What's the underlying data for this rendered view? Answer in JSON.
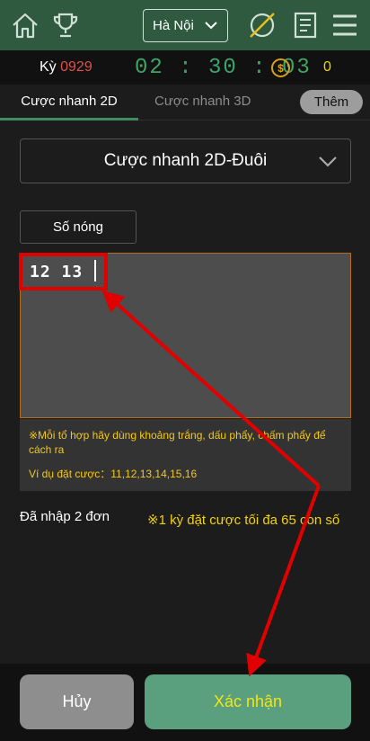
{
  "header": {
    "region_selected": "Hà Nội",
    "icons": [
      "home-icon",
      "trophy-icon",
      "chevron-down-icon",
      "no-sound-icon",
      "document-icon",
      "menu-icon"
    ]
  },
  "info": {
    "period_label": "Kỳ",
    "period_number": "0929",
    "countdown": "02 : 30 : 03",
    "coin_symbol": "$",
    "balance": "0"
  },
  "tabs": {
    "active": "Cược nhanh 2D",
    "inactive": "Cược nhanh 3D",
    "more": "Thêm"
  },
  "bet_type": "Cược nhanh 2D-Đuôi",
  "hot_numbers_label": "Số nóng",
  "input_value": "12 13",
  "note": {
    "instruction": "※Mỗi tổ hợp hãy dùng khoảng trắng, dấu phẩy, chấm phẩy để cách ra",
    "example": "Ví dụ đặt cược：11,12,13,14,15,16"
  },
  "entered_count": "Đã nhập 2 đơn",
  "limit_text": "※1 kỳ đặt cược tối đa 65 con số",
  "actions": {
    "cancel": "Hủy",
    "confirm": "Xác nhận"
  },
  "colors": {
    "header_bg": "#2f5a3f",
    "accent_green": "#3fa46a",
    "highlight_red": "#e00000",
    "note_yellow": "#f2c81a",
    "confirm_bg": "#5aa07e"
  }
}
